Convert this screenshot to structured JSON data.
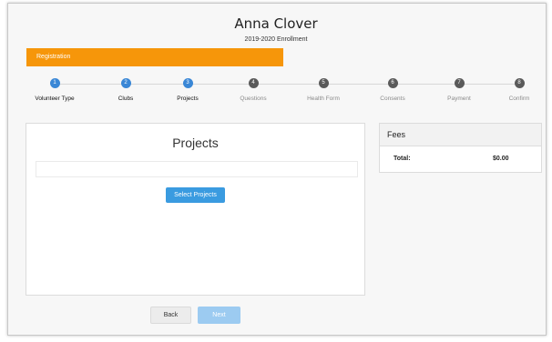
{
  "header": {
    "name": "Anna Clover",
    "subtitle": "2019-2020 Enrollment"
  },
  "registration_banner": "Registration",
  "steps": [
    {
      "num": "1",
      "label": "Volunteer Type",
      "state": "active"
    },
    {
      "num": "2",
      "label": "Clubs",
      "state": "active"
    },
    {
      "num": "3",
      "label": "Projects",
      "state": "active"
    },
    {
      "num": "4",
      "label": "Questions",
      "state": "inactive"
    },
    {
      "num": "5",
      "label": "Health Form",
      "state": "inactive"
    },
    {
      "num": "6",
      "label": "Consents",
      "state": "inactive"
    },
    {
      "num": "7",
      "label": "Payment",
      "state": "inactive"
    },
    {
      "num": "8",
      "label": "Confirm",
      "state": "inactive"
    }
  ],
  "projects": {
    "title": "Projects",
    "select_label": "Select Projects"
  },
  "fees": {
    "title": "Fees",
    "total_label": "Total:",
    "total_value": "$0.00"
  },
  "nav": {
    "back_label": "Back",
    "next_label": "Next"
  },
  "colors": {
    "accent": "#f6960a",
    "step_active": "#3a87d6",
    "step_inactive": "#5a5a5a",
    "primary_button": "#3a9be0",
    "next_disabled": "#9ccbf1"
  }
}
